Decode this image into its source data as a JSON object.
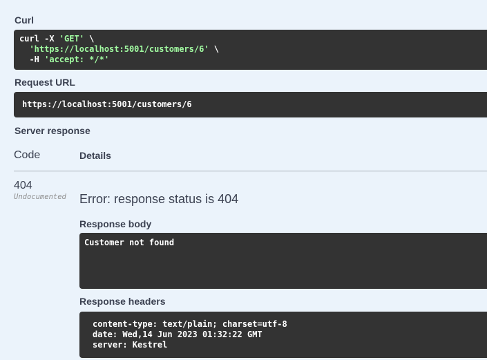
{
  "curl": {
    "heading": "Curl",
    "line1_cmd": "curl -X ",
    "line1_method": "'GET'",
    "line1_cont": " \\",
    "line2_indent": "  ",
    "line2_url": "'https://localhost:5001/customers/6'",
    "line2_cont": " \\",
    "line3_flag": "  -H ",
    "line3_header": "'accept: */*'"
  },
  "request_url": {
    "heading": "Request URL",
    "value": "https://localhost:5001/customers/6"
  },
  "server_response": {
    "heading": "Server response",
    "col_code": "Code",
    "col_details": "Details",
    "status_code": "404",
    "status_note": "Undocumented",
    "error_message": "Error: response status is 404",
    "body_heading": "Response body",
    "body_text": "Customer not found",
    "headers_heading": "Response headers",
    "headers": [
      "content-type: text/plain; charset=utf-8",
      "date: Wed,14 Jun 2023 01:32:22 GMT",
      "server: Kestrel"
    ]
  }
}
